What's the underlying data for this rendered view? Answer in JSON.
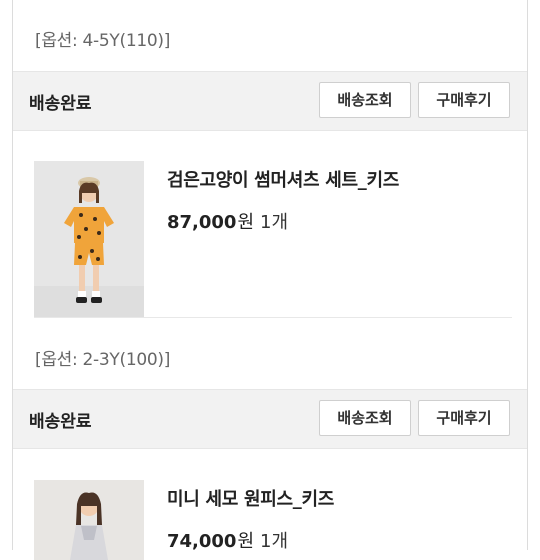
{
  "orders": [
    {
      "option_text": "[옵션: 4-5Y(110)]"
    },
    {
      "status": "배송완료",
      "track_label": "배송조회",
      "review_label": "구매후기",
      "product_name": "검은고양이 썸머셔츠 세트_키즈",
      "price": "87,000",
      "won": "원",
      "qty": "1개",
      "option_text": "[옵션: 2-3Y(100)]"
    },
    {
      "status": "배송완료",
      "track_label": "배송조회",
      "review_label": "구매후기",
      "product_name": "미니 세모 원피스_키즈",
      "price": "74,000",
      "won": "원",
      "qty": "1개"
    }
  ],
  "colors": {
    "status_bg": "#f2f2f2",
    "shirt": "#f0a43a",
    "text": "#222222"
  }
}
